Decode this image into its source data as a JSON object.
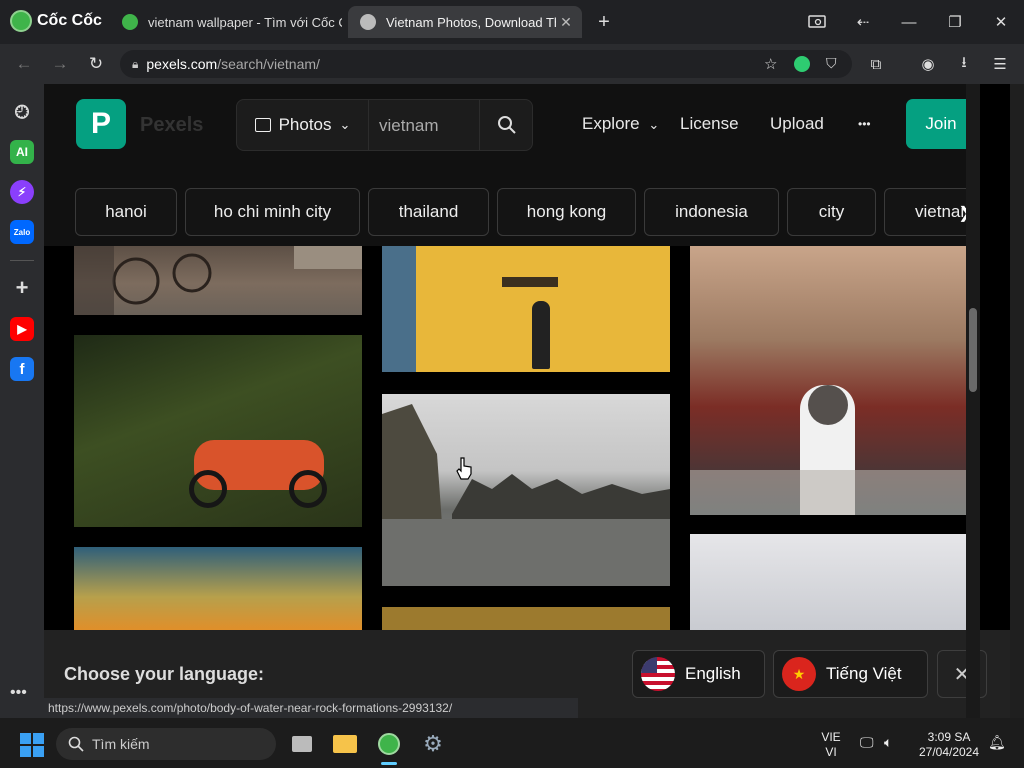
{
  "browser": {
    "brand": "Cốc Cốc",
    "tabs": [
      {
        "title": "vietnam wallpaper - Tìm với Cốc Cốc",
        "active": false
      },
      {
        "title": "Vietnam Photos, Download The BEST Free Vietnam Stock Photos & HD Images",
        "active": true
      }
    ],
    "new_tab": "+",
    "url_host": "pexels.com",
    "url_path": "/search/vietnam/",
    "status_url": "https://www.pexels.com/photo/body-of-water-near-rock-formations-2993132/"
  },
  "pexels": {
    "logo_text": "Pexels",
    "search_type": "Photos",
    "search_value": "vietnam",
    "nav": {
      "explore": "Explore",
      "license": "License",
      "upload": "Upload",
      "more": "•••"
    },
    "join": "Join",
    "chips": [
      "hanoi",
      "ho chi minh city",
      "thailand",
      "hong kong",
      "indonesia",
      "city",
      "vietnam"
    ]
  },
  "language_banner": {
    "title": "Choose your language:",
    "options": [
      {
        "label": "English"
      },
      {
        "label": "Tiếng Việt"
      }
    ],
    "close": "✕"
  },
  "taskbar": {
    "search_placeholder": "Tìm kiếm",
    "lang_top": "VIE",
    "lang_bottom": "VI",
    "time": "3:09 SA",
    "date": "27/04/2024"
  },
  "colors": {
    "accent": "#05a081",
    "background": "#000000"
  }
}
